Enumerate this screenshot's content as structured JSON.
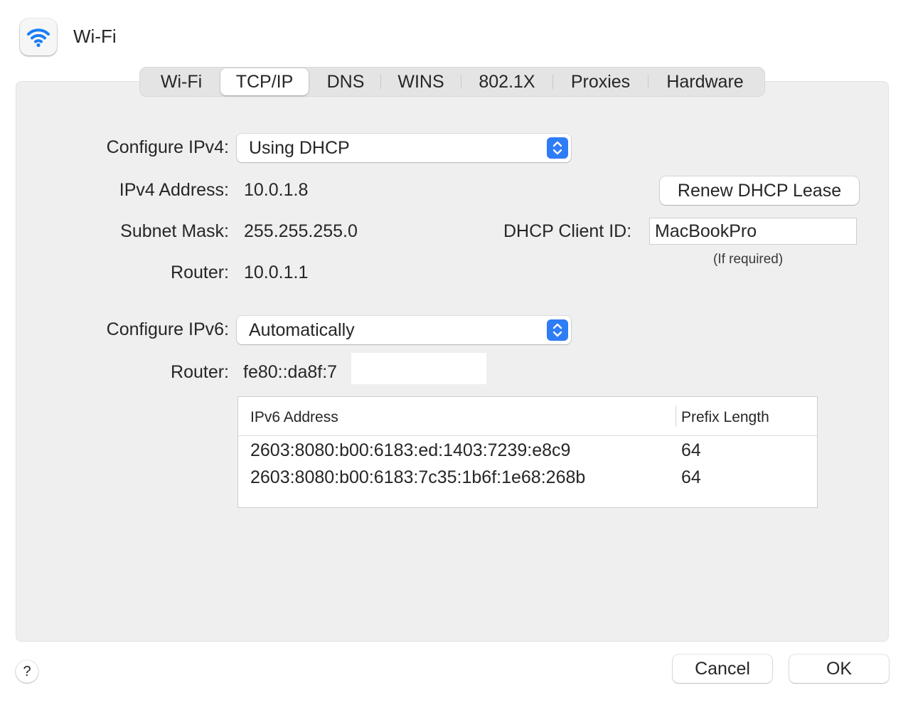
{
  "window": {
    "title": "Wi-Fi",
    "icon": "wifi-icon"
  },
  "tabs": [
    {
      "label": "Wi-Fi"
    },
    {
      "label": "TCP/IP",
      "active": true
    },
    {
      "label": "DNS"
    },
    {
      "label": "WINS"
    },
    {
      "label": "802.1X"
    },
    {
      "label": "Proxies"
    },
    {
      "label": "Hardware"
    }
  ],
  "ipv4": {
    "configure_label": "Configure IPv4:",
    "configure_value": "Using DHCP",
    "address_label": "IPv4 Address:",
    "address_value": "10.0.1.8",
    "subnet_label": "Subnet Mask:",
    "subnet_value": "255.255.255.0",
    "router_label": "Router:",
    "router_value": "10.0.1.1"
  },
  "dhcp": {
    "renew_label": "Renew DHCP Lease",
    "client_id_label": "DHCP Client ID:",
    "client_id_value": "MacBookPro",
    "client_id_hint": "(If required)"
  },
  "ipv6": {
    "configure_label": "Configure IPv6:",
    "configure_value": "Automatically",
    "router_label": "Router:",
    "router_value": "fe80::da8f:7"
  },
  "ipv6_table": {
    "headers": [
      "IPv6 Address",
      "Prefix Length"
    ],
    "rows": [
      [
        "2603:8080:b00:6183:ed:1403:7239:e8c9",
        "64"
      ],
      [
        "2603:8080:b00:6183:7c35:1b6f:1e68:268b",
        "64"
      ]
    ]
  },
  "footer": {
    "help_label": "?",
    "cancel_label": "Cancel",
    "ok_label": "OK"
  },
  "colors": {
    "accent": "#2e7cf6",
    "wifi": "#1a7ef5"
  }
}
